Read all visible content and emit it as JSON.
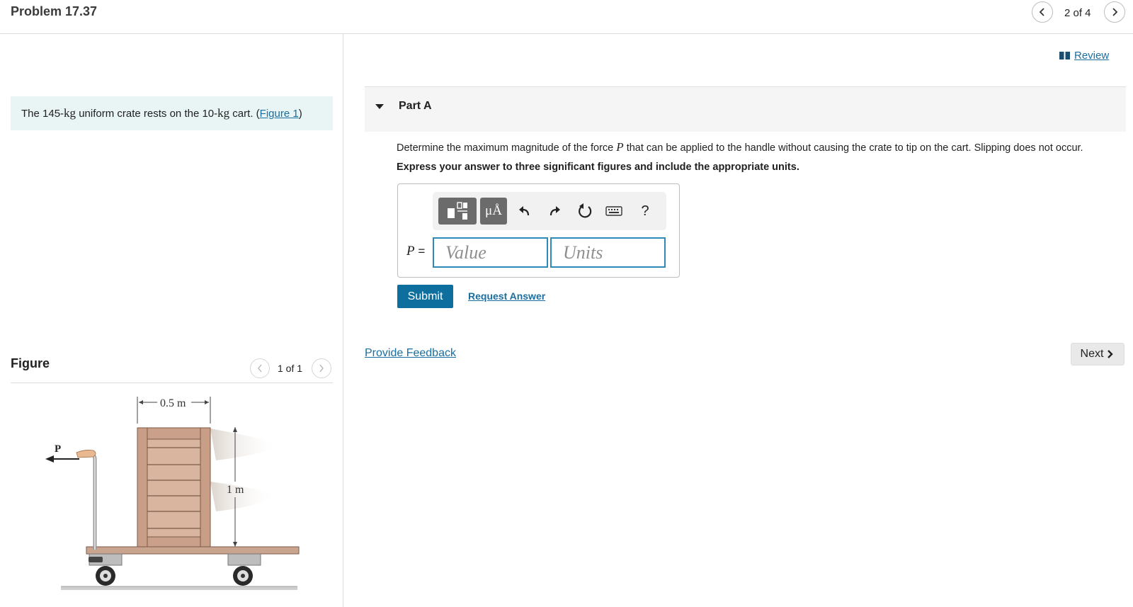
{
  "header": {
    "problem_title": "Problem 17.37",
    "pager_text": "2 of 4"
  },
  "intro": {
    "before": "The 145-",
    "unit1": "kg",
    "middle": " uniform crate rests on the 10-",
    "unit2": "kg",
    "after": " cart. (",
    "figure_link": "Figure 1",
    "close": ")"
  },
  "figure": {
    "label": "Figure",
    "pager_text": "1 of 1",
    "dim_width": "0.5 m",
    "dim_height": "1 m",
    "force_label": "P"
  },
  "review": {
    "label": "Review"
  },
  "part": {
    "title": "Part A",
    "question_before": "Determine the maximum magnitude of the force ",
    "question_var": "P",
    "question_after": " that can be applied to the handle without causing the crate to tip on the cart. Slipping does not occur.",
    "instruction": "Express your answer to three significant figures and include the appropriate units."
  },
  "answer": {
    "var": "P",
    "equals": " =",
    "value_placeholder": "Value",
    "units_placeholder": "Units",
    "toolbar": {
      "units_symbol": "μÅ",
      "help_symbol": "?"
    }
  },
  "actions": {
    "submit_label": "Submit",
    "request_label": "Request Answer",
    "feedback_label": "Provide Feedback",
    "next_label": "Next"
  }
}
